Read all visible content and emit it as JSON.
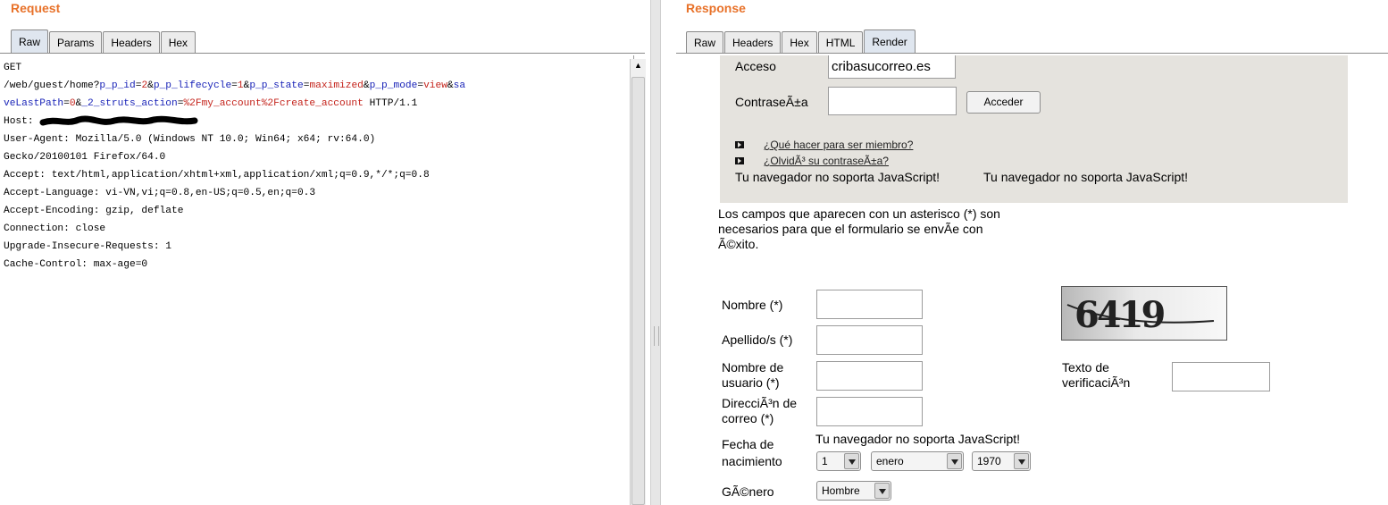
{
  "request": {
    "title": "Request",
    "tabs": [
      "Raw",
      "Params",
      "Headers",
      "Hex"
    ],
    "active_tab": "Raw",
    "lines": {
      "l1": "GET",
      "l2a": "/web/guest/home?",
      "l2_k1": "p_p_id",
      "l2_v1": "2",
      "l2_k2": "p_p_lifecycle",
      "l2_v2": "1",
      "l2_k3": "p_p_state",
      "l2_v3": "maximized",
      "l2_k4": "p_p_mode",
      "l2_v4": "view",
      "l2_k5a": "sa",
      "l3_k5b": "veLastPath",
      "l3_v5": "0",
      "l3_k6": "_2_struts_action",
      "l3_v6": "%2Fmy_account%2Fcreate_account",
      "l3_tail": " HTTP/1.1",
      "l4": "Host: ",
      "l5": "User-Agent: Mozilla/5.0 (Windows NT 10.0; Win64; x64; rv:64.0)",
      "l6": "Gecko/20100101 Firefox/64.0",
      "l7": "Accept: text/html,application/xhtml+xml,application/xml;q=0.9,*/*;q=0.8",
      "l8": "Accept-Language: vi-VN,vi;q=0.8,en-US;q=0.5,en;q=0.3",
      "l9": "Accept-Encoding: gzip, deflate",
      "l10": "Connection: close",
      "l11": "Upgrade-Insecure-Requests: 1",
      "l12": "Cache-Control: max-age=0"
    }
  },
  "response": {
    "title": "Response",
    "tabs": [
      "Raw",
      "Headers",
      "Hex",
      "HTML",
      "Render"
    ],
    "active_tab": "Render",
    "login": {
      "acceso_label": "Acceso",
      "acceso_value": "cribasucorreo.es",
      "password_label": "ContraseÃ±a",
      "submit": "Acceder",
      "link1": "¿Qué hacer para ser miembro?",
      "link2": "¿OlvidÃ³ su contraseÃ±a?",
      "nojs1": "Tu navegador no soporta JavaScript!",
      "nojs2": "Tu navegador no soporta JavaScript!"
    },
    "intro": {
      "line1": "Los campos que aparecen con un asterisco (*) son",
      "line2": "necesarios para que el formulario se envÃ­e con",
      "line3": "Ã©xito."
    },
    "form": {
      "nombre": "Nombre (*)",
      "apellidos": "Apellido/s (*)",
      "usuario_1": "Nombre de",
      "usuario_2": "usuario (*)",
      "correo_1": "DirecciÃ³n de",
      "correo_2": "correo (*)",
      "fecha_1": "Fecha de",
      "fecha_2": "nacimiento",
      "fecha_nojs": "Tu navegador no soporta JavaScript!",
      "day": "1",
      "month": "enero",
      "year": "1970",
      "genero": "GÃ©nero",
      "genero_value": "Hombre",
      "verif_1": "Texto de",
      "verif_2": "verificaciÃ³n",
      "captcha_text": "6419"
    }
  }
}
